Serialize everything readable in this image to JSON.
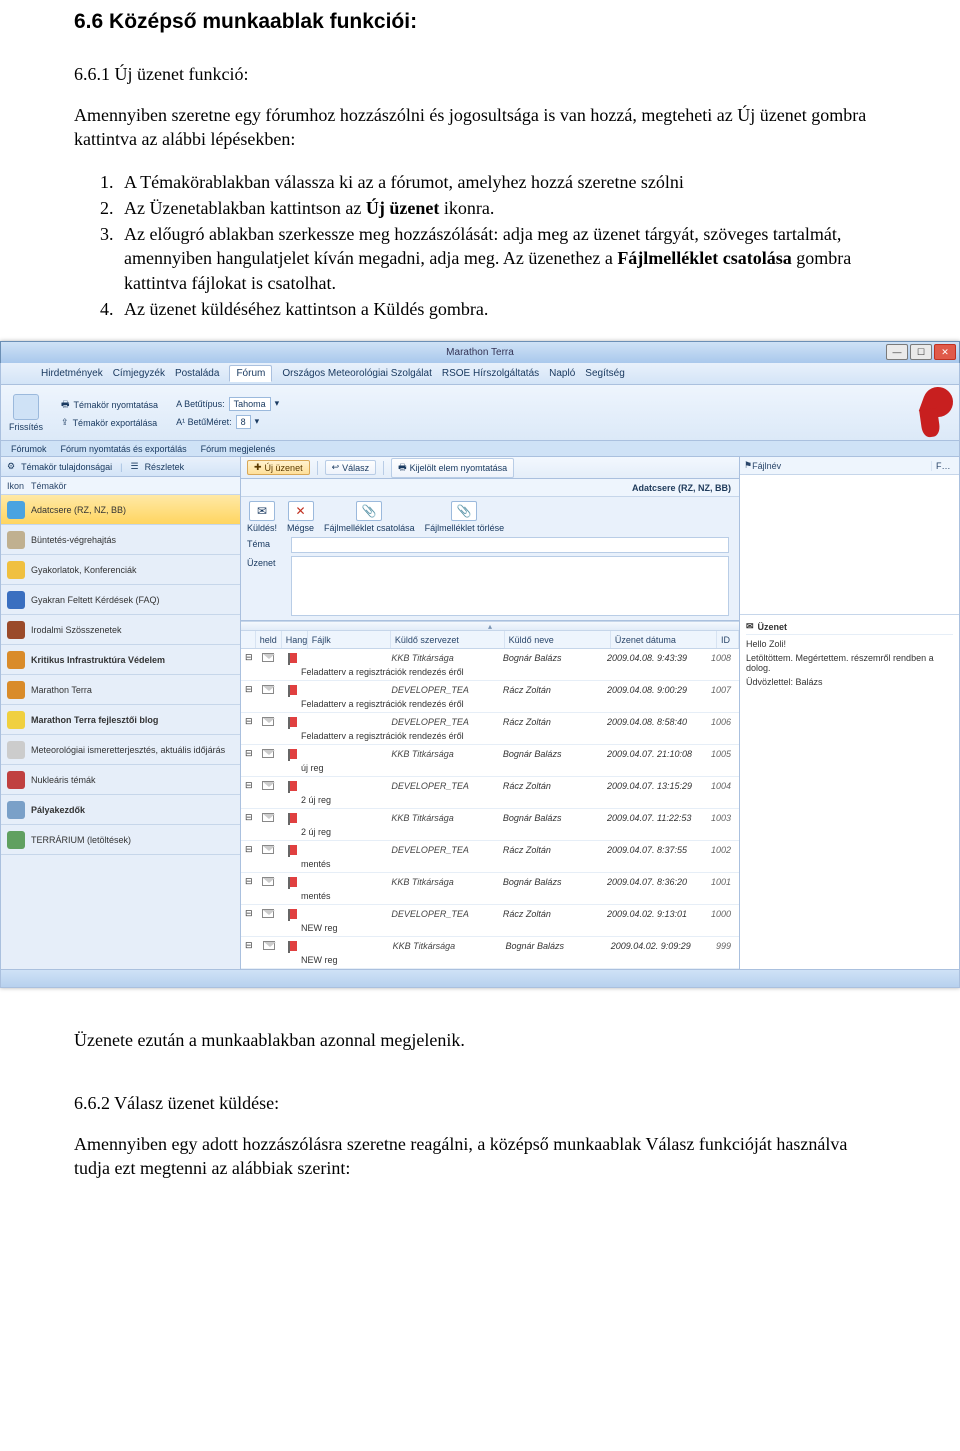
{
  "doc": {
    "section_6_6": "6.6 Középső munkaablak funkciói:",
    "section_6_6_1": "6.6.1 Új üzenet funkció:",
    "intro_661_a": "Amennyiben szeretne egy fórumhoz hozzászólni és jogosultsága is van hozzá, megteheti az Új üzenet gombra kattintva az alábbi lépésekben:",
    "step1_a": "A Témakörablakban válassza ki az a fórumot, amelyhez hozzá szeretne szólni",
    "step2_a": "Az Üzenetablakban kattintson az ",
    "step2_b": "Új üzenet",
    "step2_c": " ikonra.",
    "step3_a": "Az előugró ablakban szerkessze meg hozzászólását: adja meg az üzenet tárgyát, szöveges tartalmát, amennyiben hangulatjelet kíván megadni, adja meg. Az üzenethez a ",
    "step3_b": "Fájlmelléklet csatolása",
    "step3_c": " gombra kattintva fájlokat is csatolhat.",
    "step4": "Az üzenet küldéséhez kattintson a Küldés gombra.",
    "after": "Üzenete ezután a munkaablakban azonnal megjelenik.",
    "section_6_6_2": "6.6.2 Válasz üzenet küldése:",
    "intro_662": "Amennyiben egy adott hozzászólásra szeretne reagálni, a középső munkaablak Válasz funkcióját használva tudja ezt megtenni az alábbiak szerint:"
  },
  "win": {
    "title": "Marathon Terra",
    "menu": [
      "Hirdetmények",
      "Címjegyzék",
      "Postaláda",
      "Fórum",
      "Országos Meteorológiai Szolgálat",
      "RSOE Hírszolgáltatás",
      "Napló",
      "Segítség"
    ],
    "menu_active_index": 3,
    "ribbon": {
      "refresh": "Frissítés",
      "g1_btn1": "Témakör nyomtatása",
      "g1_btn2": "Témakör exportálása",
      "font_type_label": "A Betűtípus:",
      "font_type_value": "Tahoma",
      "font_size_label": "A¹ BetűMéret:",
      "font_size_value": "8"
    },
    "tabstrip": [
      "Fórumok",
      "Fórum nyomtatás és exportálás",
      "Fórum megjelenés"
    ],
    "left": {
      "header_btn1": "Témakör tulajdonságai",
      "header_btn2": "Részletek",
      "col_icon": "Ikon",
      "col_topic": "Témakör",
      "rows": [
        {
          "label": "Adatcsere (RZ, NZ, BB)",
          "color": "#4aa3e0",
          "sel": true
        },
        {
          "label": "Büntetés-végrehajtás",
          "color": "#c0b090"
        },
        {
          "label": "Gyakorlatok, Konferenciák",
          "color": "#f0c040"
        },
        {
          "label": "Gyakran Feltett Kérdések (FAQ)",
          "color": "#3a6fc0"
        },
        {
          "label": "Irodalmi Szösszenetek",
          "color": "#9a4a2a"
        },
        {
          "label": "Kritikus Infrastruktúra Védelem",
          "color": "#d98b2a",
          "hl": true
        },
        {
          "label": "Marathon Terra",
          "color": "#d98b2a"
        },
        {
          "label": "Marathon Terra fejlesztői blog",
          "color": "#f0d040",
          "hl": true
        },
        {
          "label": "Meteorológiai ismeretterjesztés, aktuális időjárás",
          "color": "#cccccc"
        },
        {
          "label": "Nukleáris témák",
          "color": "#c04040"
        },
        {
          "label": "Pályakezdők",
          "color": "#7aa0c8",
          "hl": true
        },
        {
          "label": "TERRÁRIUM (letöltések)",
          "color": "#60a060"
        }
      ]
    },
    "toolbar": {
      "new": "Új üzenet",
      "reply": "Válasz",
      "print": "Kijelölt elem nyomtatása"
    },
    "crumb": "Adatcsere (RZ, NZ, BB)",
    "compose": {
      "send": "Küldés!",
      "cancel": "Mégse",
      "attach": "Fájlmelléklet csatolása",
      "attach_del": "Fájlmelléklet törlése",
      "subject_label": "Téma",
      "body_label": "Üzenet"
    },
    "attach_panel": {
      "col1": "Fájlnév",
      "col2": "F…"
    },
    "msg_headers": {
      "h0": "",
      "h1": "held",
      "h2": "Hang",
      "h3": "Fájlk",
      "h4": "Küldő szervezet",
      "h5": "Küldő neve",
      "h6": "Üzenet dátuma",
      "h7": "ID"
    },
    "messages": [
      {
        "org": "KKB Titkársága",
        "sender": "Bognár Balázs",
        "date": "2009.04.08. 9:43:39",
        "id": "1008",
        "subject": "Feladatterv a regisztrációk rendezés éről"
      },
      {
        "org": "DEVELOPER_TEA",
        "sender": "Rácz Zoltán",
        "date": "2009.04.08. 9:00:29",
        "id": "1007",
        "subject": "Feladatterv a regisztrációk rendezés éről"
      },
      {
        "org": "DEVELOPER_TEA",
        "sender": "Rácz Zoltán",
        "date": "2009.04.08. 8:58:40",
        "id": "1006",
        "subject": "Feladatterv a regisztrációk rendezés éről"
      },
      {
        "org": "KKB Titkársága",
        "sender": "Bognár Balázs",
        "date": "2009.04.07. 21:10:08",
        "id": "1005",
        "subject": "új reg"
      },
      {
        "org": "DEVELOPER_TEA",
        "sender": "Rácz Zoltán",
        "date": "2009.04.07. 13:15:29",
        "id": "1004",
        "subject": "2 új reg"
      },
      {
        "org": "KKB Titkársága",
        "sender": "Bognár Balázs",
        "date": "2009.04.07. 11:22:53",
        "id": "1003",
        "subject": "2 új reg"
      },
      {
        "org": "DEVELOPER_TEA",
        "sender": "Rácz Zoltán",
        "date": "2009.04.07. 8:37:55",
        "id": "1002",
        "subject": "mentés"
      },
      {
        "org": "KKB Titkársága",
        "sender": "Bognár Balázs",
        "date": "2009.04.07. 8:36:20",
        "id": "1001",
        "subject": "mentés"
      },
      {
        "org": "DEVELOPER_TEA",
        "sender": "Rácz Zoltán",
        "date": "2009.04.02. 9:13:01",
        "id": "1000",
        "subject": "NEW reg"
      },
      {
        "org": "KKB Titkársága",
        "sender": "Bognár Balázs",
        "date": "2009.04.02. 9:09:29",
        "id": "999",
        "subject": "NEW reg"
      }
    ],
    "preview": {
      "header": "Üzenet",
      "greet": "Hello Zoli!",
      "line1": "Letöltöttem. Megértettem. részemről rendben a dolog.",
      "line2": "Üdvözlettel: Balázs"
    }
  }
}
